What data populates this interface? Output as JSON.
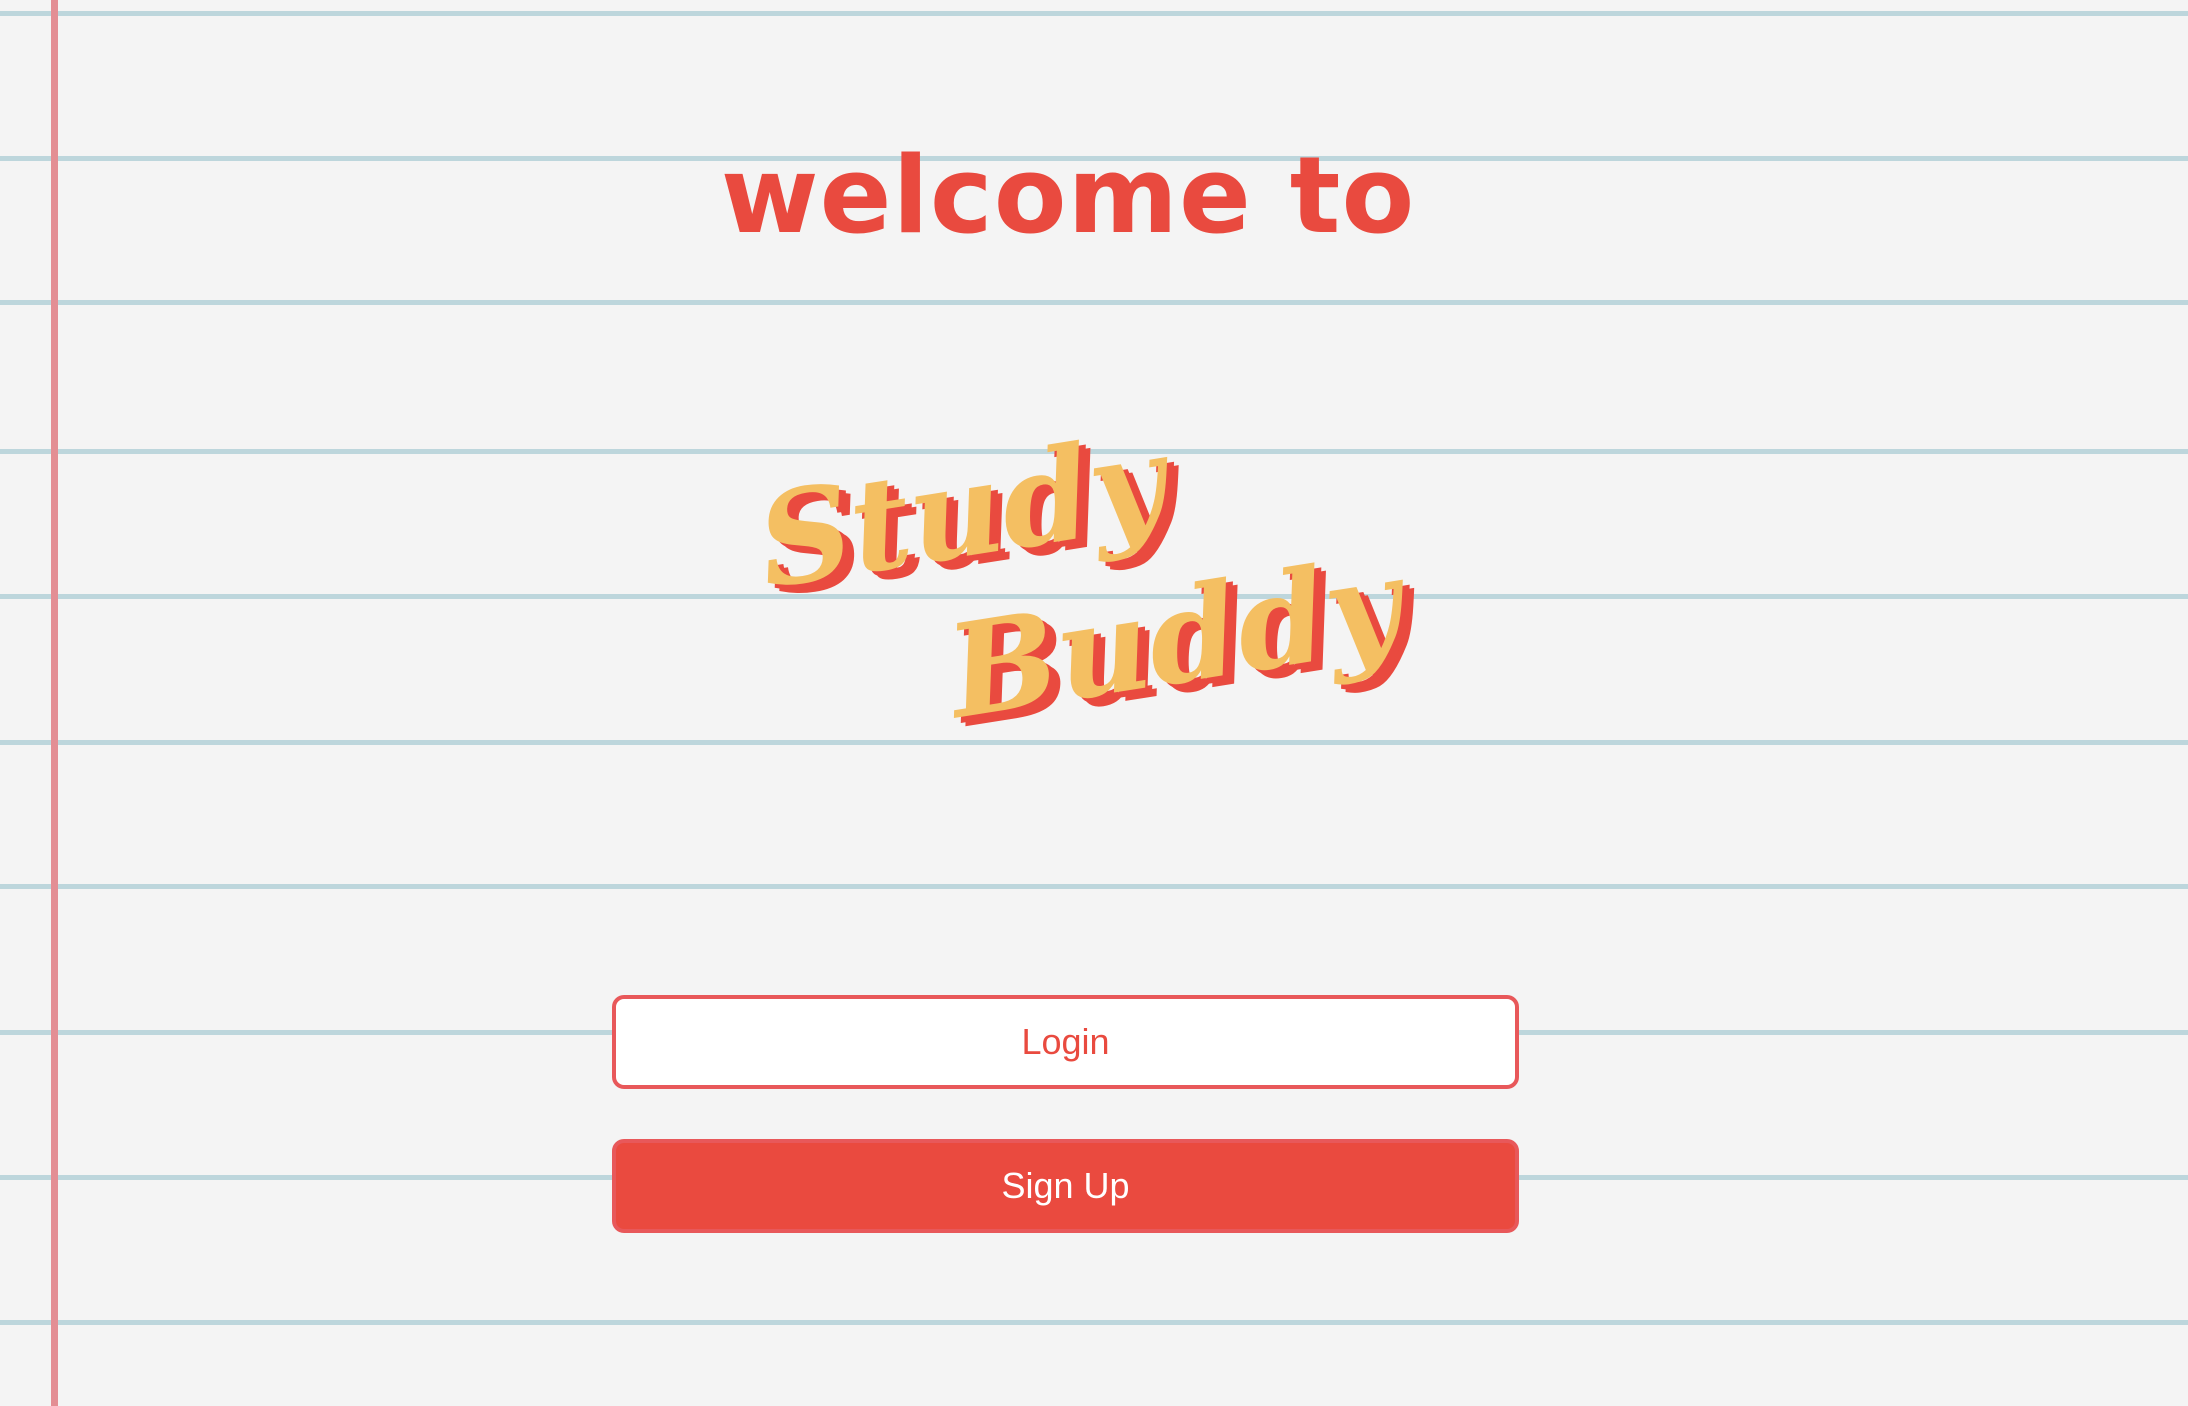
{
  "page": {
    "welcome_text": "welcome to",
    "logo": {
      "line1": "Study",
      "line2": "Buddy"
    },
    "buttons": {
      "login_label": "Login",
      "signup_label": "Sign Up"
    }
  },
  "colors": {
    "background": "#f4f4f4",
    "ruled_line": "#bdd6dc",
    "margin_line": "#e38e94",
    "accent_red": "#e94a3f",
    "logo_yellow": "#f4bf62",
    "login_bg": "#ffffff",
    "signup_bg": "#ea4a3f"
  }
}
